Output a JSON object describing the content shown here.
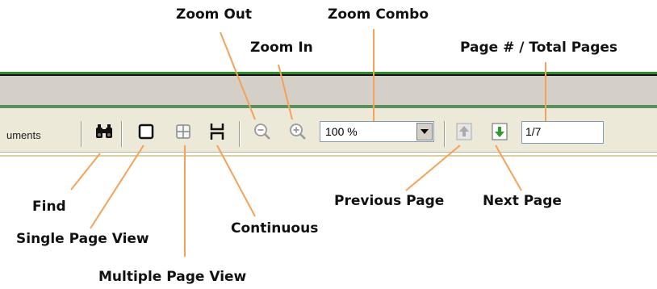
{
  "toolbar": {
    "documents_text": "uments",
    "zoom_value": "100 %",
    "page_value": "1/7"
  },
  "labels": {
    "zoom_out": "Zoom Out",
    "zoom_combo": "Zoom Combo",
    "zoom_in": "Zoom In",
    "page_total": "Page # / Total Pages",
    "find": "Find",
    "single_page_view": "Single Page View",
    "multiple_page_view": "Multiple Page View",
    "continuous": "Continuous",
    "previous_page": "Previous Page",
    "next_page": "Next Page"
  },
  "colors": {
    "leader_line": "#f4a259",
    "accent_green": "#2e8b2e",
    "next_arrow": "#2f9a2f"
  }
}
